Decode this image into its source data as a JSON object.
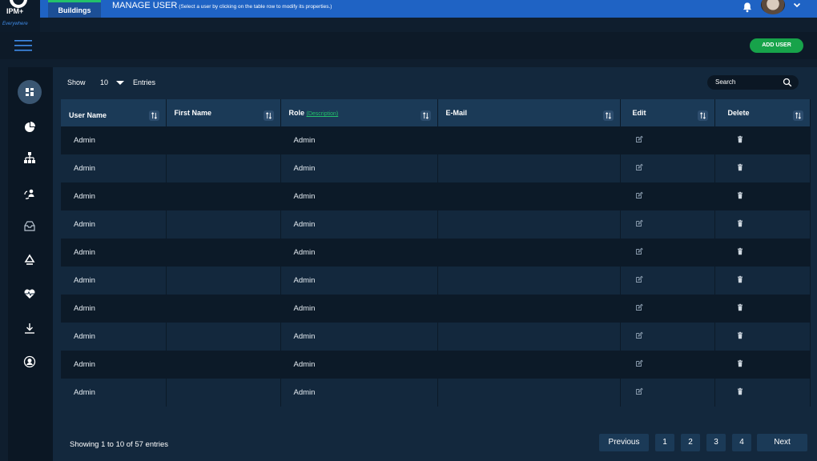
{
  "app": {
    "logo_text": "IPM+",
    "logo_tagline": "Everywhere",
    "tab_buildings": "Buildings",
    "title": "MANAGE USER",
    "title_hint": "(Select a user by clicking on the table row to modify its properties.)"
  },
  "toolbar": {
    "add_user_label": "ADD USER"
  },
  "sidebar": {
    "items": [
      {
        "icon": "dashboard-icon"
      },
      {
        "icon": "pie-chart-icon"
      },
      {
        "icon": "hierarchy-icon"
      },
      {
        "icon": "user-sync-icon"
      },
      {
        "icon": "inbox-icon"
      },
      {
        "icon": "recycle-icon"
      },
      {
        "icon": "heartbeat-icon"
      },
      {
        "icon": "download-icon"
      },
      {
        "icon": "user-circle-icon"
      }
    ]
  },
  "controls": {
    "show_label": "Show",
    "entries_value": "10",
    "entries_label": "Entries",
    "search_placeholder": "Search"
  },
  "table": {
    "headers": {
      "user_name": "User Name",
      "first_name": "First Name",
      "role": "Role",
      "role_link": "(Description)",
      "email": "E-Mail",
      "edit": "Edit",
      "delete": "Delete"
    },
    "rows": [
      {
        "user_name": "Admin",
        "first_name": "",
        "role": "Admin",
        "email": ""
      },
      {
        "user_name": "Admin",
        "first_name": "",
        "role": "Admin",
        "email": ""
      },
      {
        "user_name": "Admin",
        "first_name": "",
        "role": "Admin",
        "email": ""
      },
      {
        "user_name": "Admin",
        "first_name": "",
        "role": "Admin",
        "email": ""
      },
      {
        "user_name": "Admin",
        "first_name": "",
        "role": "Admin",
        "email": ""
      },
      {
        "user_name": "Admin",
        "first_name": "",
        "role": "Admin",
        "email": ""
      },
      {
        "user_name": "Admin",
        "first_name": "",
        "role": "Admin",
        "email": ""
      },
      {
        "user_name": "Admin",
        "first_name": "",
        "role": "Admin",
        "email": ""
      },
      {
        "user_name": "Admin",
        "first_name": "",
        "role": "Admin",
        "email": ""
      },
      {
        "user_name": "Admin",
        "first_name": "",
        "role": "Admin",
        "email": ""
      }
    ]
  },
  "footer": {
    "info": "Showing 1 to 10 of 57 entries",
    "previous": "Previous",
    "pages": [
      "1",
      "2",
      "3",
      "4"
    ],
    "next": "Next"
  },
  "colors": {
    "topbar": "#1f63c4",
    "accent_green": "#17a34a",
    "header_row": "#1b3a57"
  }
}
